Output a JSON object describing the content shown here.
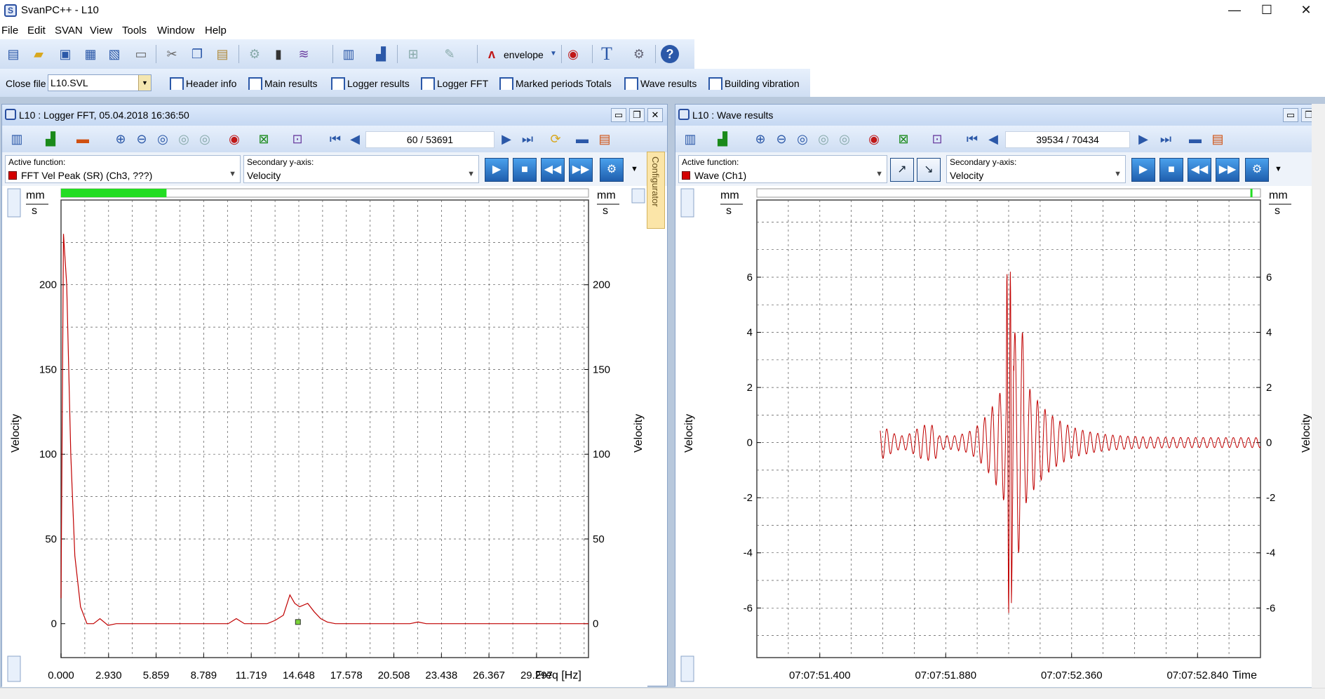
{
  "app": {
    "title": "SvanPC++ - L10",
    "icon_letter": "S"
  },
  "window_controls": {
    "minimize": "—",
    "maximize": "☐",
    "close": "✕"
  },
  "menu": [
    "File",
    "Edit",
    "SVAN",
    "View",
    "Tools",
    "Window",
    "Help"
  ],
  "toolbar1": {
    "envelope_label": "envelope"
  },
  "toolbar2": {
    "close_file_label": "Close file",
    "file_value": "L10.SVL",
    "buttons": [
      "Header info",
      "Main results",
      "Logger results",
      "Logger FFT",
      "Marked periods Totals",
      "Wave results",
      "Building vibration"
    ]
  },
  "configurator_label": "Configurator",
  "fft_window": {
    "title": "L10 : Logger FFT, 05.04.2018 16:36:50",
    "counter": "60 / 53691",
    "active_function_label": "Active function:",
    "active_function_value": "FFT Vel Peak (SR) (Ch3, ???)",
    "secondary_label": "Secondary y-axis:",
    "secondary_value": "Velocity",
    "unit_top": "mm",
    "unit_bottom": "s",
    "ylabel": "Velocity",
    "progress_fraction": 0.2
  },
  "wave_window": {
    "title": "L10 : Wave results",
    "counter": "39534 / 70434",
    "active_function_label": "Active function:",
    "active_function_value": "Wave (Ch1)",
    "secondary_label": "Secondary y-axis:",
    "secondary_value": "Velocity",
    "unit_top": "mm",
    "unit_bottom": "s",
    "ylabel": "Velocity",
    "progress_fraction": 0.98
  },
  "colors": {
    "trace": "#c00000",
    "progress": "#22dd22",
    "accent": "#2b58a8"
  },
  "chart_data": [
    {
      "type": "line",
      "title": "",
      "xlabel": "Freq [Hz]",
      "ylabel": "Velocity",
      "x_ticks": [
        "0.000",
        "2.930",
        "5.859",
        "8.789",
        "11.719",
        "14.648",
        "17.578",
        "20.508",
        "23.438",
        "26.367",
        "29.297"
      ],
      "y_ticks": [
        "0",
        "50",
        "100",
        "150",
        "200"
      ],
      "xlim": [
        0,
        32.5
      ],
      "ylim": [
        -20,
        250
      ],
      "grid": true,
      "series": [
        {
          "color": "#c00000",
          "x": [
            0.0,
            0.15,
            0.35,
            0.6,
            0.85,
            1.2,
            1.6,
            2.0,
            2.4,
            2.9,
            3.4,
            3.9,
            4.5,
            5.0,
            6.0,
            8.0,
            9.5,
            10.3,
            10.8,
            11.3,
            12.0,
            12.7,
            13.2,
            13.7,
            14.1,
            14.4,
            14.7,
            15.2,
            15.6,
            16.0,
            16.4,
            16.9,
            17.5,
            20.0,
            21.5,
            22.0,
            22.5,
            23.0,
            25.0,
            32.5
          ],
          "values": [
            15,
            230,
            200,
            100,
            40,
            10,
            0,
            0,
            3,
            -1,
            0,
            0,
            0,
            0,
            0,
            0,
            0,
            0,
            3,
            0,
            0,
            0,
            2,
            5,
            17,
            12,
            10,
            12,
            7,
            3,
            1,
            0,
            0,
            0,
            0,
            1,
            0,
            0,
            0,
            0
          ]
        }
      ],
      "marker": {
        "x": 14.6,
        "y": 1
      }
    },
    {
      "type": "line",
      "title": "",
      "xlabel": "Time",
      "ylabel": "Velocity",
      "x_ticks": [
        "07:07:51.400",
        "07:07:51.880",
        "07:07:52.360",
        "07:07:52.840"
      ],
      "y_ticks": [
        "-6",
        "-4",
        "-2",
        "0",
        "2",
        "4",
        "6"
      ],
      "xlim": [
        0,
        1.0
      ],
      "ylim": [
        -7.8,
        8.8
      ],
      "grid": true,
      "series": [
        {
          "color": "#c00000",
          "name": "",
          "generator": "decaying-oscillation"
        }
      ]
    }
  ]
}
